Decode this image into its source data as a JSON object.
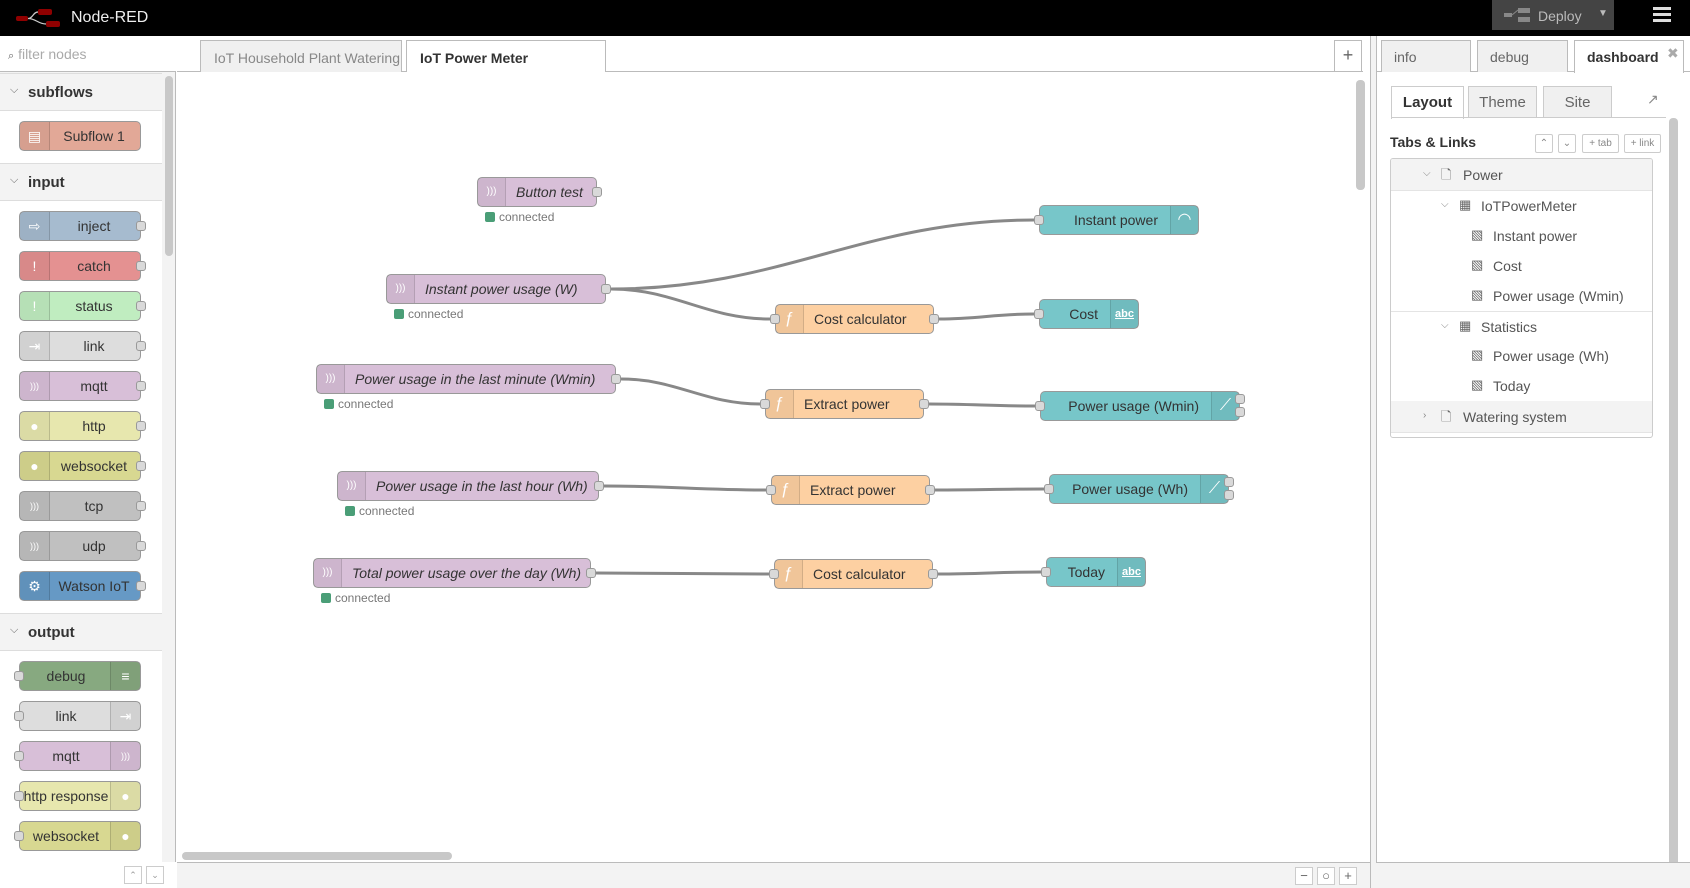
{
  "header": {
    "title": "Node-RED",
    "deploy_label": "Deploy"
  },
  "palette": {
    "filter_placeholder": "filter nodes",
    "categories": [
      {
        "name": "subflows",
        "nodes": [
          {
            "label": "Subflow 1",
            "color": "#e2a897",
            "icon": "subflow-icon",
            "dir": "in",
            "port": false
          }
        ]
      },
      {
        "name": "input",
        "nodes": [
          {
            "label": "inject",
            "color": "#a6bbcf",
            "icon": "inject-icon",
            "dir": "in"
          },
          {
            "label": "catch",
            "color": "#e49191",
            "icon": "alert-icon",
            "dir": "in"
          },
          {
            "label": "status",
            "color": "#c0edc0",
            "icon": "alert-icon",
            "dir": "in"
          },
          {
            "label": "link",
            "color": "#dddddd",
            "icon": "link-icon",
            "dir": "in"
          },
          {
            "label": "mqtt",
            "color": "#d8bfd8",
            "icon": "bridge-icon",
            "dir": "in"
          },
          {
            "label": "http",
            "color": "#e7e7ae",
            "icon": "globe-icon",
            "dir": "in"
          },
          {
            "label": "websocket",
            "color": "#d8d891",
            "icon": "globe-icon",
            "dir": "in"
          },
          {
            "label": "tcp",
            "color": "#c0c0c0",
            "icon": "bridge-icon",
            "dir": "in"
          },
          {
            "label": "udp",
            "color": "#c0c0c0",
            "icon": "bridge-icon",
            "dir": "in"
          },
          {
            "label": "Watson IoT",
            "color": "#6699c5",
            "icon": "watson-iot-icon",
            "dir": "in"
          }
        ]
      },
      {
        "name": "output",
        "nodes": [
          {
            "label": "debug",
            "color": "#87a980",
            "icon": "debug-icon",
            "dir": "out"
          },
          {
            "label": "link",
            "color": "#dddddd",
            "icon": "link-icon",
            "dir": "out"
          },
          {
            "label": "mqtt",
            "color": "#d8bfd8",
            "icon": "bridge-icon",
            "dir": "out"
          },
          {
            "label": "http response",
            "color": "#e7e7ae",
            "icon": "globe-icon",
            "dir": "out"
          },
          {
            "label": "websocket",
            "color": "#d8d891",
            "icon": "globe-icon",
            "dir": "out"
          }
        ]
      }
    ]
  },
  "workspace": {
    "tabs": [
      {
        "label": "IoT Household Plant Watering",
        "active": false
      },
      {
        "label": "IoT Power Meter",
        "active": true
      }
    ],
    "add_tab": "+",
    "zoom_controls": [
      "−",
      "○",
      "+"
    ]
  },
  "flow": {
    "nodes": [
      {
        "id": "n1",
        "type": "mqtt",
        "label": "Button test",
        "status": "connected"
      },
      {
        "id": "n2",
        "type": "mqtt",
        "label": "Instant power usage (W)",
        "status": "connected"
      },
      {
        "id": "n3",
        "type": "mqtt",
        "label": "Power usage in the last minute (Wmin)",
        "status": "connected"
      },
      {
        "id": "n4",
        "type": "mqtt",
        "label": "Power usage in the last hour (Wh)",
        "status": "connected"
      },
      {
        "id": "n5",
        "type": "mqtt",
        "label": "Total power usage over the day (Wh)",
        "status": "connected"
      },
      {
        "id": "f1",
        "type": "function",
        "label": "Cost calculator"
      },
      {
        "id": "f2",
        "type": "function",
        "label": "Extract power"
      },
      {
        "id": "f3",
        "type": "function",
        "label": "Extract power"
      },
      {
        "id": "f4",
        "type": "function",
        "label": "Cost calculator"
      },
      {
        "id": "u1",
        "type": "gauge",
        "label": "Instant power",
        "icon": "gauge-icon"
      },
      {
        "id": "u2",
        "type": "text",
        "label": "Cost",
        "icon": "abc-icon"
      },
      {
        "id": "u3",
        "type": "chart",
        "label": "Power usage (Wmin)",
        "icon": "chart-icon"
      },
      {
        "id": "u4",
        "type": "chart",
        "label": "Power usage (Wh)",
        "icon": "chart-icon"
      },
      {
        "id": "u5",
        "type": "text",
        "label": "Today",
        "icon": "abc-icon"
      }
    ],
    "wires": [
      [
        "n2",
        "u1"
      ],
      [
        "n2",
        "f1"
      ],
      [
        "f1",
        "u2"
      ],
      [
        "n3",
        "f2"
      ],
      [
        "f2",
        "u3"
      ],
      [
        "n4",
        "f3"
      ],
      [
        "f3",
        "u4"
      ],
      [
        "n5",
        "f4"
      ],
      [
        "f4",
        "u5"
      ]
    ]
  },
  "sidebar": {
    "tabs": [
      {
        "label": "info"
      },
      {
        "label": "debug"
      },
      {
        "label": "dashboard",
        "active": true
      }
    ],
    "close": "✖",
    "dashboard": {
      "subtabs": [
        "Layout",
        "Theme",
        "Site"
      ],
      "section_title": "Tabs & Links",
      "buttons": {
        "up": "⌃",
        "down": "⌄",
        "add_tab": "+ tab",
        "add_link": "+ link"
      },
      "tree": [
        {
          "level": 0,
          "kind": "tab",
          "label": "Power",
          "expanded": true
        },
        {
          "level": 1,
          "kind": "group",
          "label": "IoTPowerMeter",
          "expanded": true
        },
        {
          "level": 2,
          "kind": "widget",
          "label": "Instant power"
        },
        {
          "level": 2,
          "kind": "widget",
          "label": "Cost"
        },
        {
          "level": 2,
          "kind": "widget",
          "label": "Power usage (Wmin)"
        },
        {
          "level": 1,
          "kind": "group",
          "label": "Statistics",
          "expanded": true
        },
        {
          "level": 2,
          "kind": "widget",
          "label": "Power usage (Wh)"
        },
        {
          "level": 2,
          "kind": "widget",
          "label": "Today"
        },
        {
          "level": 0,
          "kind": "tab",
          "label": "Watering system",
          "expanded": false
        }
      ]
    }
  }
}
